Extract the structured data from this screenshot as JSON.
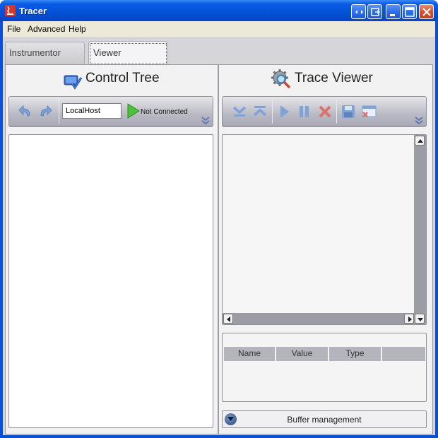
{
  "window": {
    "title": "Tracer"
  },
  "menu": {
    "file": "File",
    "advanced": "Advanced",
    "help": "Help"
  },
  "tabs": [
    {
      "label": "Instrumentor",
      "selected": false
    },
    {
      "label": "Viewer",
      "selected": true
    }
  ],
  "control_tree": {
    "title": "Control Tree",
    "host_value": "LocalHost",
    "status": "Not Connected",
    "toolbar_icons": [
      "undo-icon",
      "redo-icon",
      "connect-play-icon",
      "expand-chevron-icon"
    ]
  },
  "trace_viewer": {
    "title": "Trace Viewer",
    "toolbar_icons": [
      "scroll-bottom-icon",
      "scroll-top-icon",
      "play-icon",
      "pause-icon",
      "clear-icon",
      "save-icon",
      "close-window-icon",
      "expand-chevron-icon"
    ],
    "columns": [
      "Name",
      "Value",
      "Type",
      ""
    ],
    "buffer_label": "Buffer management"
  },
  "colors": {
    "titlebar": "#0a5ce6",
    "panel_bg": "#f2f2f2",
    "toolbar_gradient_bottom": "#a9a9b6",
    "table_header": "#b4b4bc"
  }
}
